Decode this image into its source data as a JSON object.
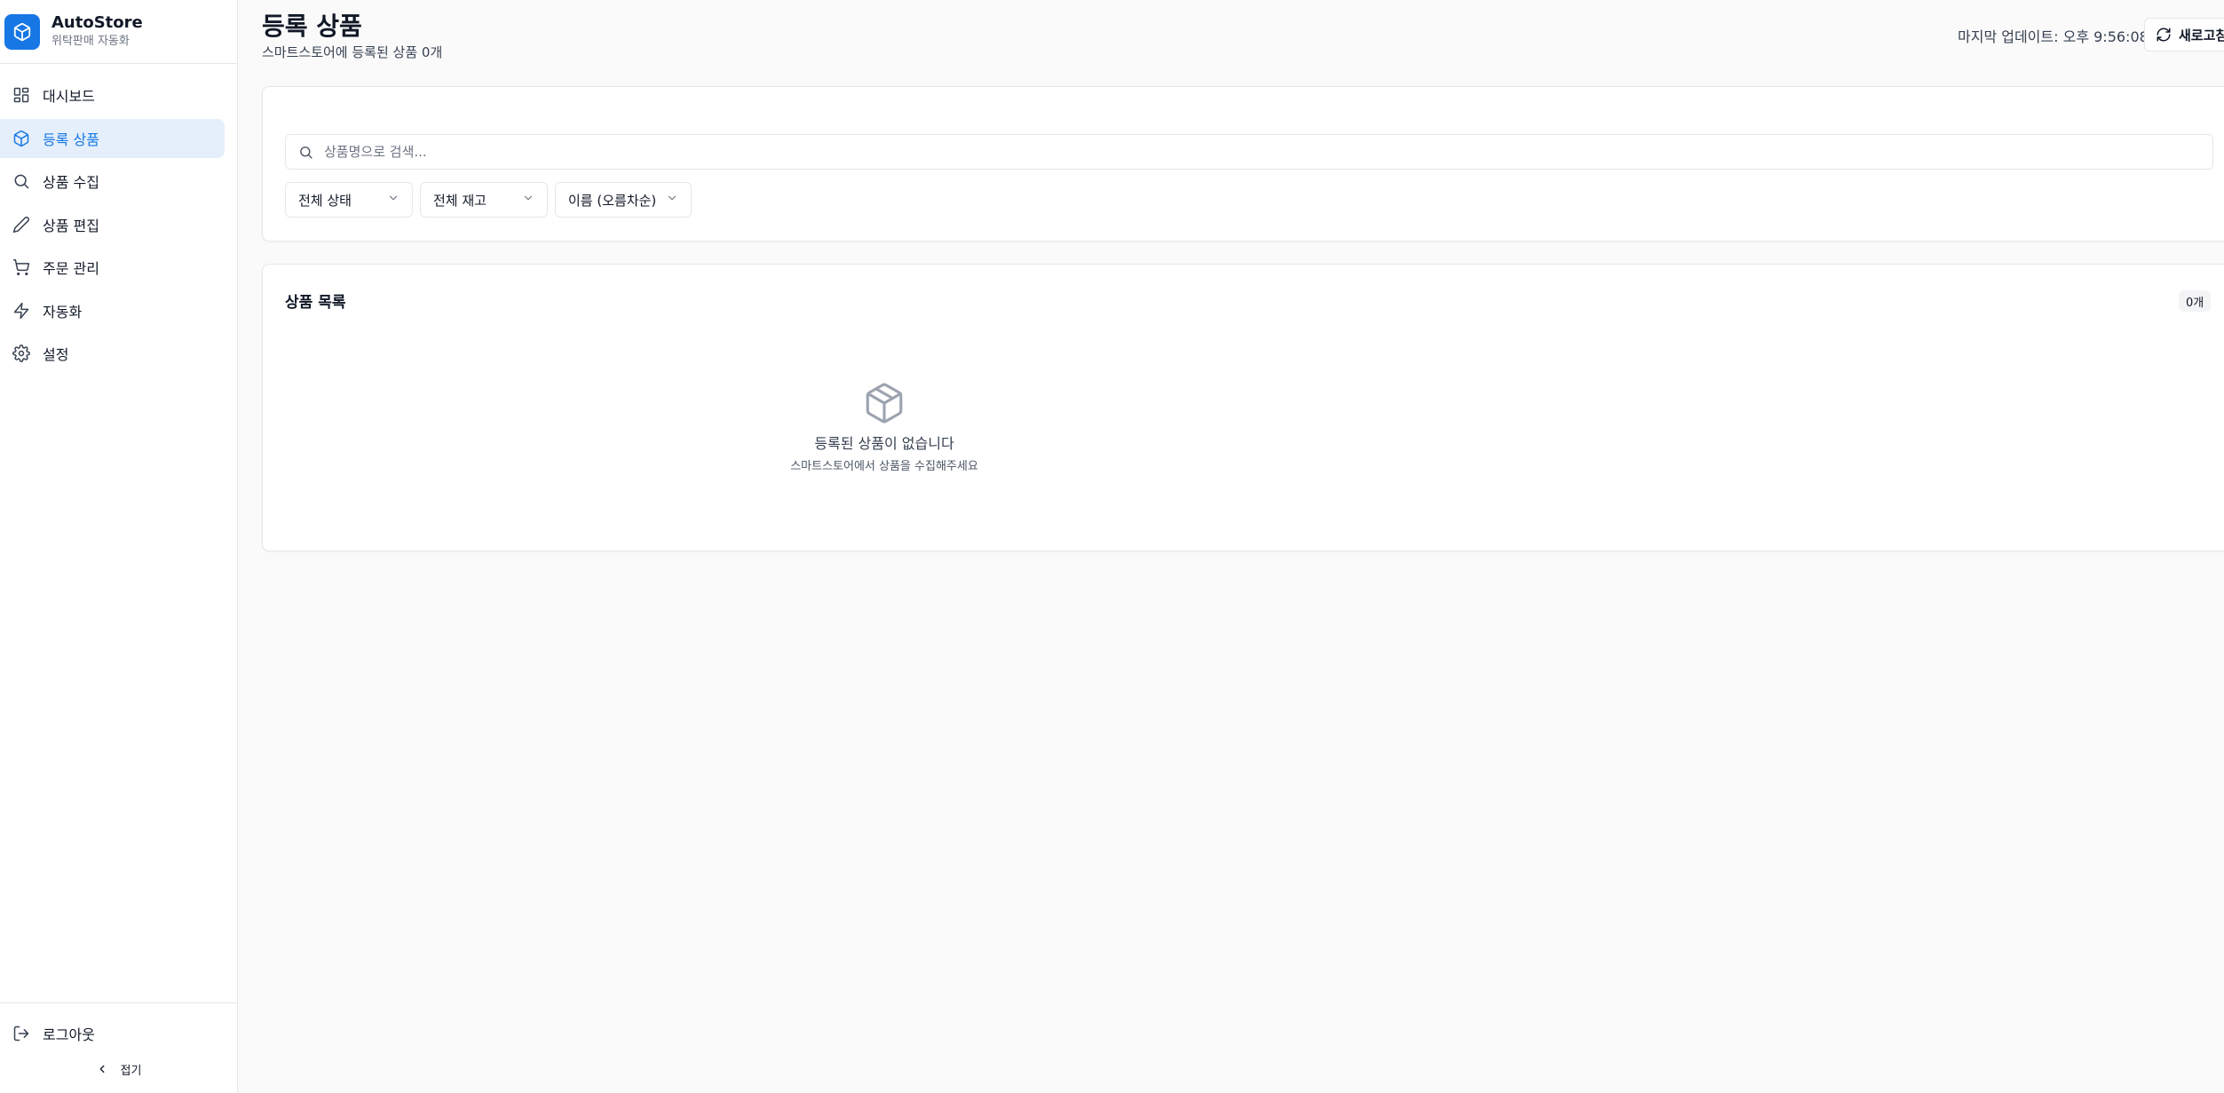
{
  "brand": {
    "name": "AutoStore",
    "subtitle": "위탁판매 자동화",
    "color": "#1677e5"
  },
  "sidebar": {
    "items": [
      {
        "label": "대시보드",
        "icon": "dashboard-icon",
        "active": false
      },
      {
        "label": "등록 상품",
        "icon": "package-icon",
        "active": true
      },
      {
        "label": "상품 수집",
        "icon": "search-icon",
        "active": false
      },
      {
        "label": "상품 편집",
        "icon": "pencil-icon",
        "active": false
      },
      {
        "label": "주문 관리",
        "icon": "cart-icon",
        "active": false
      },
      {
        "label": "자동화",
        "icon": "lightning-icon",
        "active": false
      },
      {
        "label": "설정",
        "icon": "gear-icon",
        "active": false
      }
    ],
    "logout_label": "로그아웃",
    "collapse_label": "접기"
  },
  "header": {
    "title": "등록 상품",
    "subtitle": "스마트스토어에 등록된 상품 0개",
    "last_update": "마지막 업데이트: 오후 9:56:08",
    "refresh_label": "새로고침"
  },
  "filters": {
    "search_placeholder": "상품명으로 검색...",
    "search_value": "",
    "status_select": "전체 상태",
    "stock_select": "전체 재고",
    "sort_select": "이름 (오름차순)"
  },
  "product_list": {
    "title": "상품 목록",
    "count": "0개",
    "empty_title": "등록된 상품이 없습니다",
    "empty_subtitle": "스마트스토어에서 상품을 수집해주세요"
  }
}
